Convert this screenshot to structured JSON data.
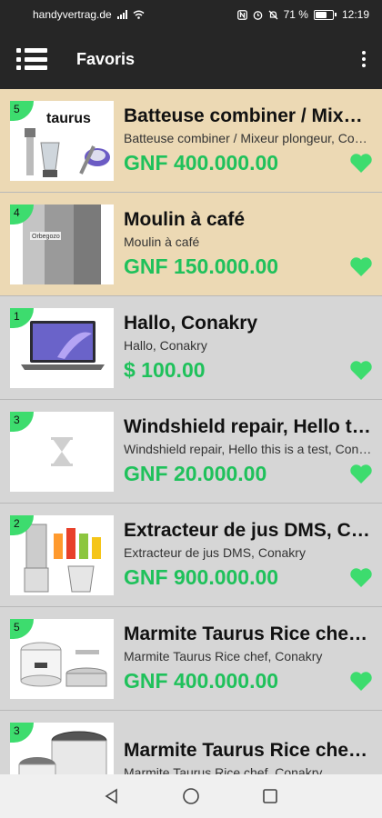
{
  "status_bar": {
    "carrier": "handyvertrag.de",
    "battery_percent": "71 %",
    "time": "12:19",
    "battery_level": 0.71
  },
  "toolbar": {
    "title": "Favoris",
    "menu_icon": "menu-icon",
    "overflow_icon": "more-vert-icon"
  },
  "colors": {
    "toolbar_bg": "#262626",
    "featured_bg": "#ecd9b4",
    "plain_bg": "#d6d6d6",
    "price": "#1fc15b",
    "badge": "#3ddc6e",
    "heart": "#3ddc6e"
  },
  "items": [
    {
      "badge": "5",
      "title": "Batteuse combiner / Mixeur plongeur",
      "subtitle": "Batteuse combiner / Mixeur plongeur, Conakry",
      "price": "GNF 400.000.00",
      "featured": true
    },
    {
      "badge": "4",
      "title": "Moulin à café",
      "subtitle": "Moulin à café",
      "price": "GNF 150.000.00",
      "featured": true
    },
    {
      "badge": "1",
      "title": "Hallo, Conakry",
      "subtitle": "Hallo, Conakry",
      "price": "$ 100.00",
      "featured": false
    },
    {
      "badge": "3",
      "title": "Windshield repair, Hello this is a test",
      "subtitle": "Windshield repair, Hello this is a test, Conakry",
      "price": "GNF 20.000.00",
      "featured": false
    },
    {
      "badge": "2",
      "title": "Extracteur de jus DMS, Conakry",
      "subtitle": "Extracteur de jus DMS, Conakry",
      "price": "GNF 900.000.00",
      "featured": false
    },
    {
      "badge": "5",
      "title": "Marmite Taurus Rice chef, Conakry",
      "subtitle": "Marmite Taurus Rice chef, Conakry",
      "price": "GNF 400.000.00",
      "featured": false
    },
    {
      "badge": "3",
      "title": "Marmite Taurus Rice chef, Conakry",
      "subtitle": "Marmite Taurus Rice chef, Conakry",
      "price": "",
      "featured": false
    }
  ],
  "thumb_texts": {
    "taurus_logo": "taurus",
    "grinder_brand": "Orbegozo"
  },
  "nav_bar": {
    "back_icon": "back-triangle-icon",
    "home_icon": "home-circle-icon",
    "recents_icon": "recents-square-icon"
  }
}
